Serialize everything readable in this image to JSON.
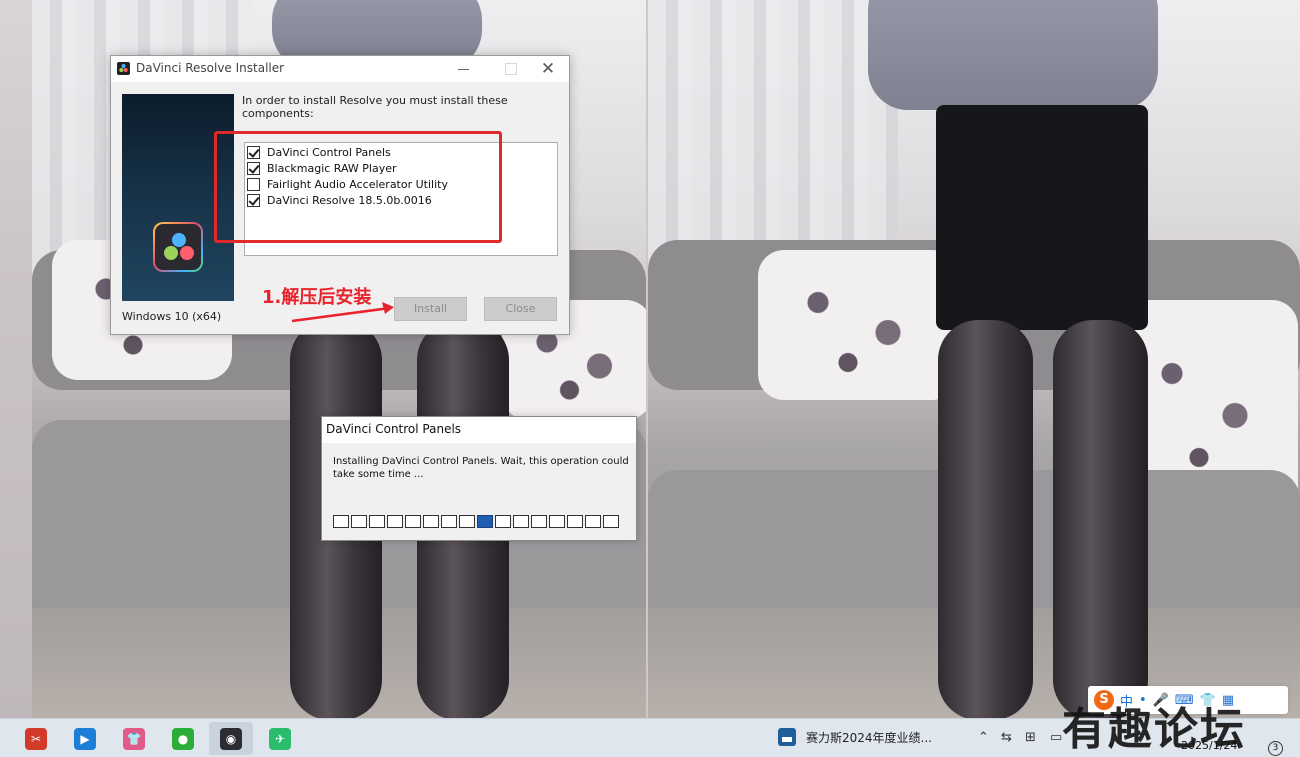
{
  "installer": {
    "title": "DaVinci Resolve Installer",
    "close_glyph": "✕",
    "prompt": "In order to install Resolve you must install these components:",
    "os_label": "Windows 10 (x64)",
    "components": [
      {
        "label": "DaVinci Control Panels",
        "checked": true
      },
      {
        "label": "Blackmagic RAW Player",
        "checked": true
      },
      {
        "label": "Fairlight Audio Accelerator Utility",
        "checked": false
      },
      {
        "label": "DaVinci Resolve 18.5.0b.0016",
        "checked": true
      }
    ],
    "install_label": "Install",
    "close_label": "Close",
    "annotation": "1.解压后安装",
    "annotation_color": "#e8232b"
  },
  "progress_dialog": {
    "title": "DaVinci Control Panels",
    "message": "Installing DaVinci Control Panels. Wait, this operation could take some time ...",
    "segments_total": 16,
    "active_segment": 9
  },
  "taskbar": {
    "apps": [
      {
        "name": "app-red",
        "glyph": "✂",
        "color": "#d23a2a"
      },
      {
        "name": "app-blue",
        "glyph": "▶",
        "color": "#1d7ed8"
      },
      {
        "name": "app-shirt",
        "glyph": "👕",
        "color": "#e05a8a"
      },
      {
        "name": "app-wechat",
        "glyph": "●",
        "color": "#2aae38"
      },
      {
        "name": "app-resolve",
        "glyph": "◉",
        "color": "#2b2d33"
      },
      {
        "name": "app-green",
        "glyph": "✈",
        "color": "#2bbd6e"
      }
    ],
    "notification_text": "赛力斯2024年度业绩...",
    "clock_date": "2025/1/24",
    "notification_count": "3"
  },
  "ime": {
    "logo": "S",
    "mode": "中"
  },
  "watermark": "有趣论坛",
  "colors": {
    "accent_red": "#e02a2a",
    "progress_blue": "#1e5fb3"
  }
}
